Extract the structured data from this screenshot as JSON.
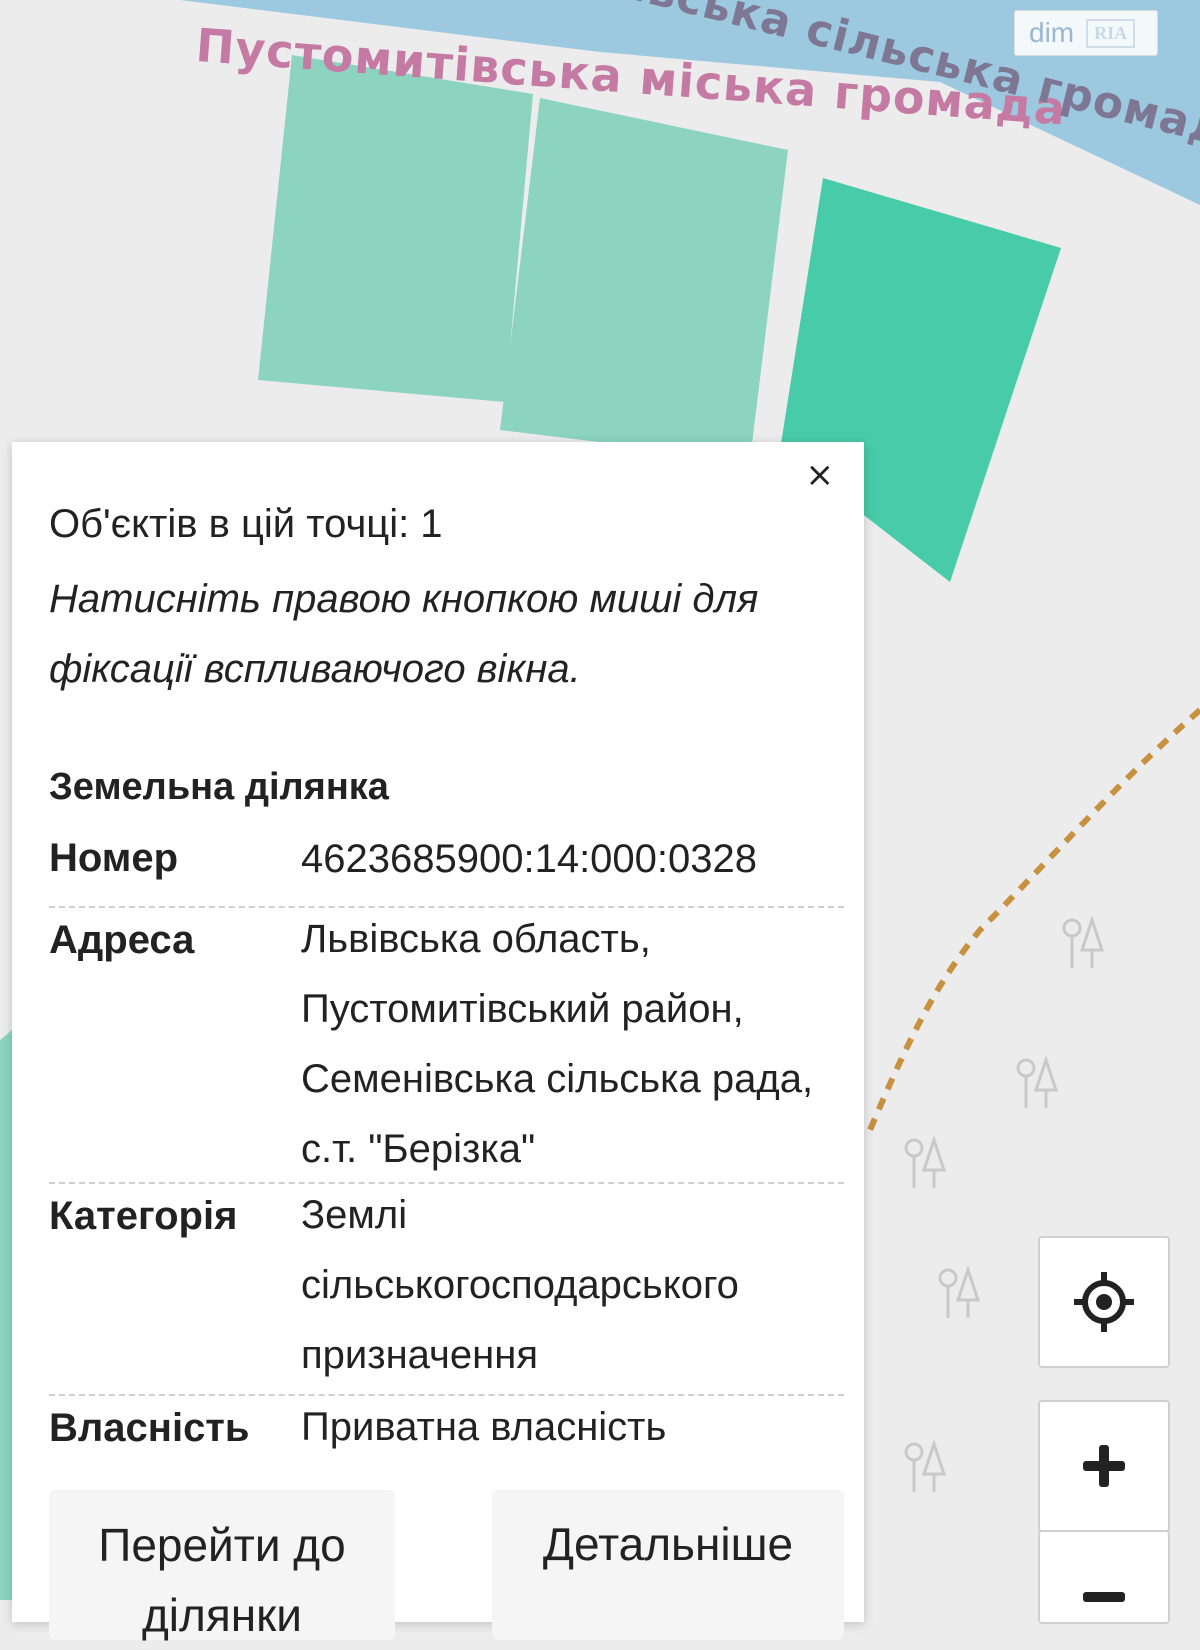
{
  "map": {
    "label_left": "Пустомитівська міська громада",
    "label_right": "івська сільська громада",
    "watermark": {
      "dim": "dim",
      "ria": "RIA"
    },
    "colors": {
      "background": "#ececec",
      "river": "#9cc9df",
      "parcel_light": "#8cd4c0",
      "parcel_selected": "#48cba8",
      "path": "#c8913f",
      "tree": "#c9c9c9"
    }
  },
  "popup": {
    "close_label": "×",
    "count_label": "Об'єктів в цій точці: 1",
    "hint": "Натисніть правою кнопкою миші для фіксації вспливаючого вікна.",
    "section_title": "Земельна ділянка",
    "rows": [
      {
        "key": "Номер",
        "value": "4623685900:14:000:0328"
      },
      {
        "key": "Адреса",
        "value": "Львівська область, Пустомитівський район, Семенівська сільська рада, с.т. \"Берізка\""
      },
      {
        "key": "Категорія",
        "value": "Землі сільськогосподарського призначення"
      },
      {
        "key": "Власність",
        "value": "Приватна власність"
      }
    ],
    "buttons": {
      "goto": "Перейти до ділянки",
      "details": "Детальніше"
    }
  },
  "controls": {
    "locate_icon": "locate-icon",
    "zoom_in": "+",
    "zoom_out": "−"
  }
}
